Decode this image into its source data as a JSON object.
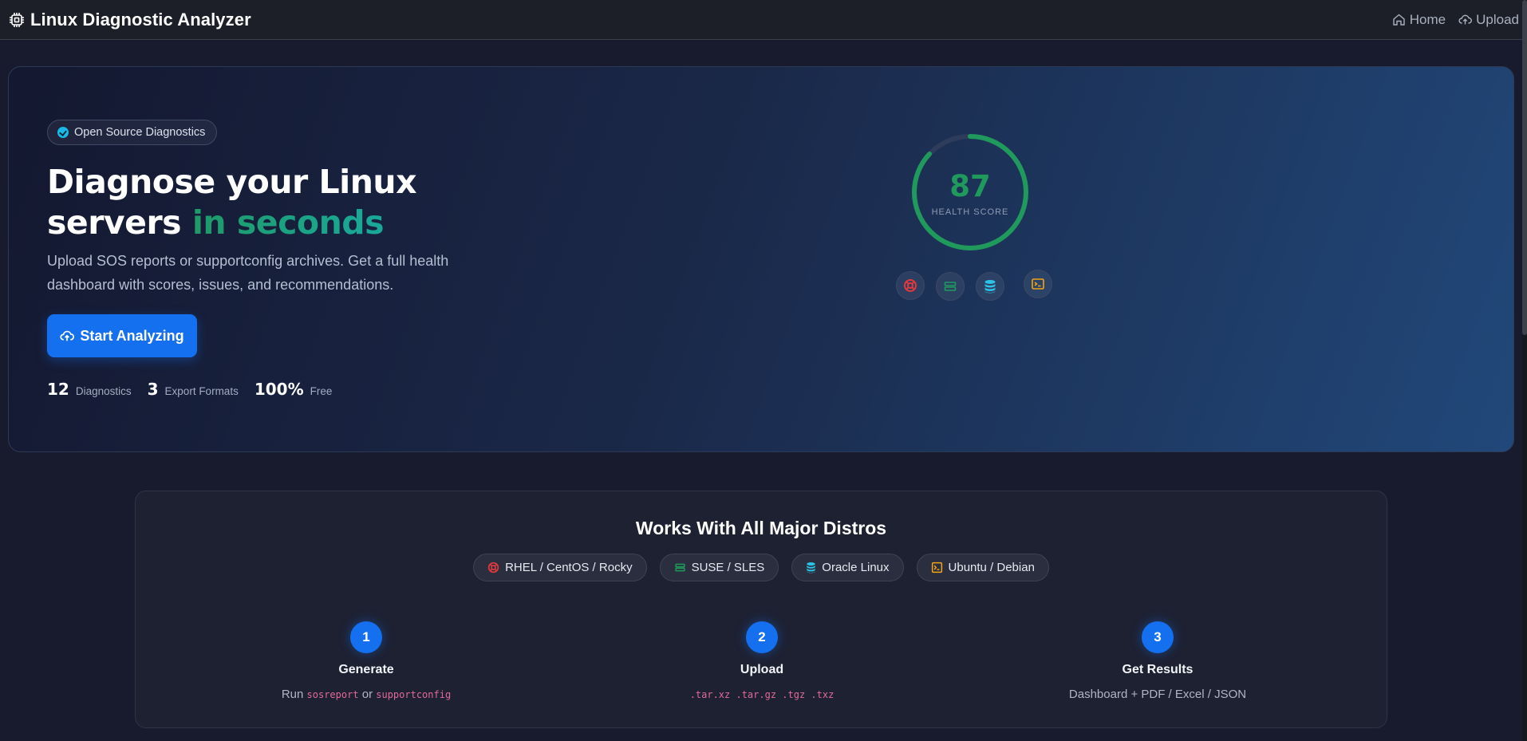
{
  "navbar": {
    "title": "Linux Diagnostic Analyzer",
    "brand_icon": "cpu-chip-icon",
    "links": [
      {
        "label": "Home",
        "icon": "house-icon"
      },
      {
        "label": "Upload",
        "icon": "cloud-upload-icon"
      }
    ]
  },
  "hero": {
    "badge": "Open Source Diagnostics",
    "title_line1": "Diagnose your Linux",
    "title_line2_plain": "servers",
    "title_line2_accent": "in seconds",
    "subtitle": "Upload SOS reports or supportconfig archives. Get a full health dashboard with scores, issues, and recommendations.",
    "cta_label": "Start Analyzing",
    "stats": [
      {
        "value": "12",
        "label": "Diagnostics"
      },
      {
        "value": "3",
        "label": "Export Formats"
      },
      {
        "value": "100%",
        "label": "Free"
      }
    ],
    "gauge": {
      "value": "87",
      "label": "HEALTH SCORE",
      "fraction": 0.87,
      "color": "#1f9a5c"
    },
    "distro_icons": [
      {
        "icon": "redhat-lifebuoy-icon",
        "color": "#e0393e"
      },
      {
        "icon": "suse-server-icon",
        "color": "#1f9a5c"
      },
      {
        "icon": "oracle-database-icon",
        "color": "#2bc4e6"
      },
      {
        "icon": "ubuntu-terminal-icon",
        "color": "#f2a516"
      }
    ]
  },
  "distros": {
    "title": "Works With All Major Distros",
    "pills": [
      {
        "label": "RHEL / CentOS / Rocky",
        "icon": "redhat-lifebuoy-icon",
        "color": "#e0393e"
      },
      {
        "label": "SUSE / SLES",
        "icon": "suse-server-icon",
        "color": "#1f9a5c"
      },
      {
        "label": "Oracle Linux",
        "icon": "oracle-database-icon",
        "color": "#2bc4e6"
      },
      {
        "label": "Ubuntu / Debian",
        "icon": "ubuntu-terminal-icon",
        "color": "#f2a516"
      }
    ],
    "steps": [
      {
        "num": "1",
        "title": "Generate",
        "desc_run": "Run",
        "desc_code1": "sosreport",
        "desc_or": "or",
        "desc_code2": "supportconfig"
      },
      {
        "num": "2",
        "title": "Upload",
        "desc_code": ".tar.xz .tar.gz .tgz .txz"
      },
      {
        "num": "3",
        "title": "Get Results",
        "desc": "Dashboard + PDF / Excel / JSON"
      }
    ]
  }
}
